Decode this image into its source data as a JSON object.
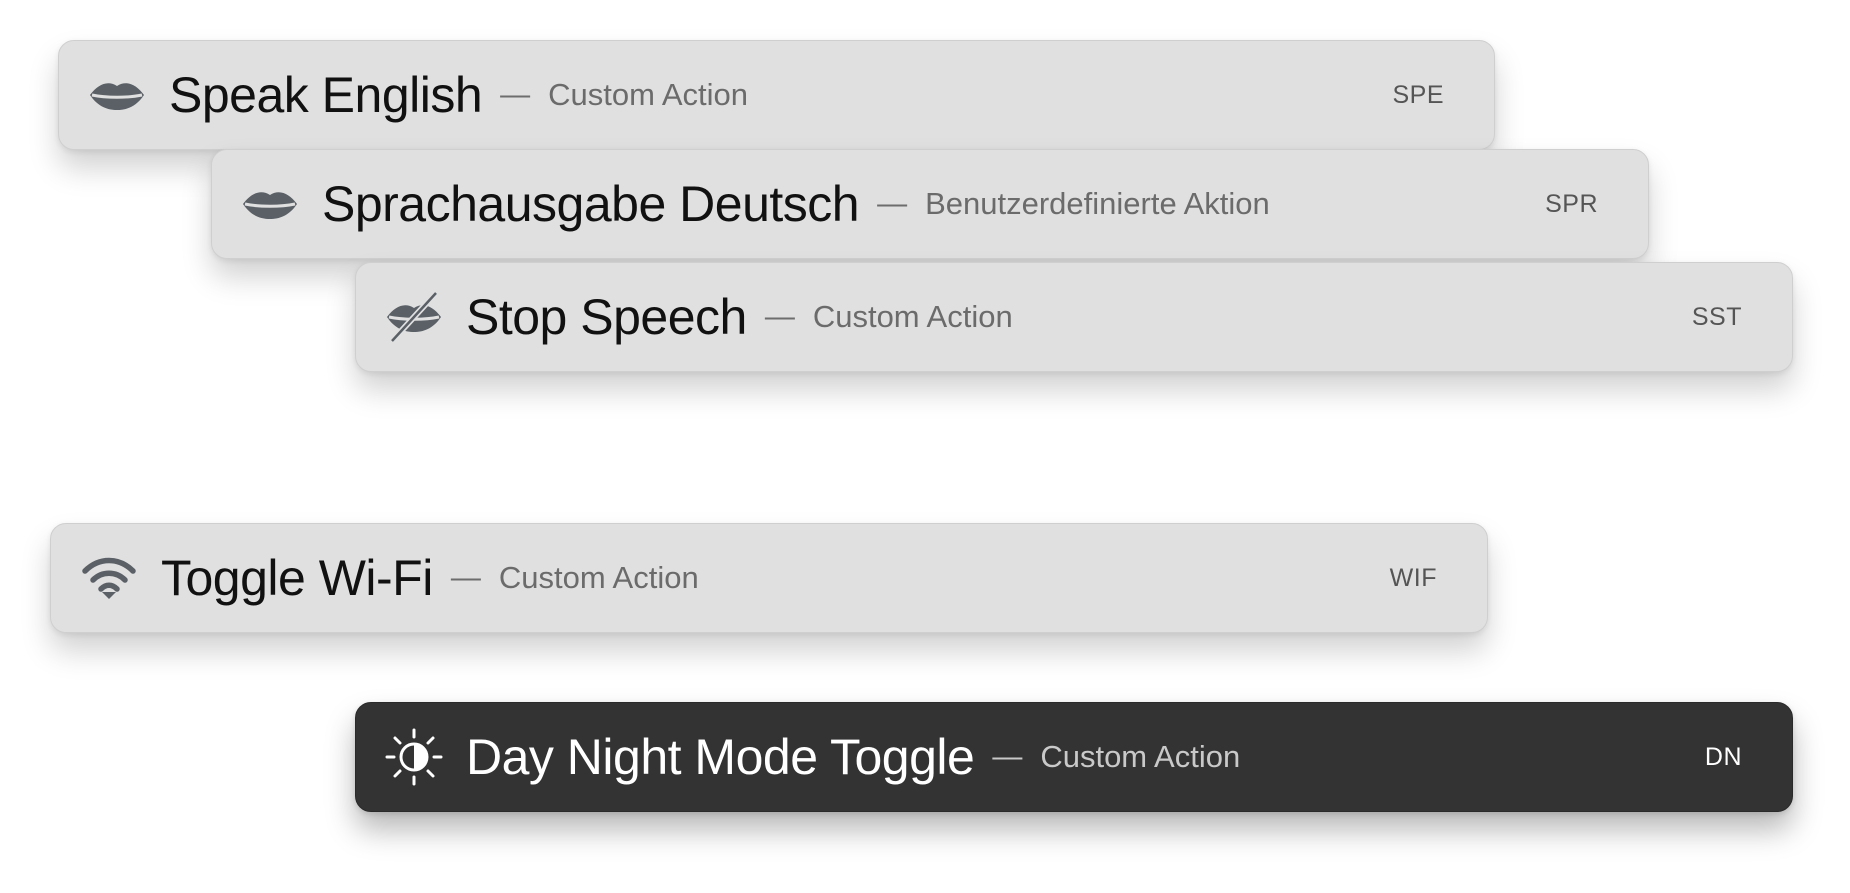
{
  "actions": [
    {
      "icon": "lips-icon",
      "title": "Speak English",
      "separator": "—",
      "subtitle": "Custom Action",
      "shortcut": "SPE"
    },
    {
      "icon": "lips-icon",
      "title": "Sprachausgabe Deutsch",
      "separator": "—",
      "subtitle": "Benutzerdefinierte Aktion",
      "shortcut": "SPR"
    },
    {
      "icon": "lips-slash-icon",
      "title": "Stop Speech",
      "separator": "—",
      "subtitle": "Custom Action",
      "shortcut": "SST"
    },
    {
      "icon": "wifi-icon",
      "title": "Toggle Wi-Fi",
      "separator": "—",
      "subtitle": "Custom Action",
      "shortcut": "WIF"
    },
    {
      "icon": "brightness-half-icon",
      "title": "Day Night Mode Toggle",
      "separator": "—",
      "subtitle": "Custom Action",
      "shortcut": "DN"
    }
  ],
  "colors": {
    "light_bar": "#e0e0e0",
    "dark_bar": "#333333",
    "icon_gray": "#5a6066"
  }
}
